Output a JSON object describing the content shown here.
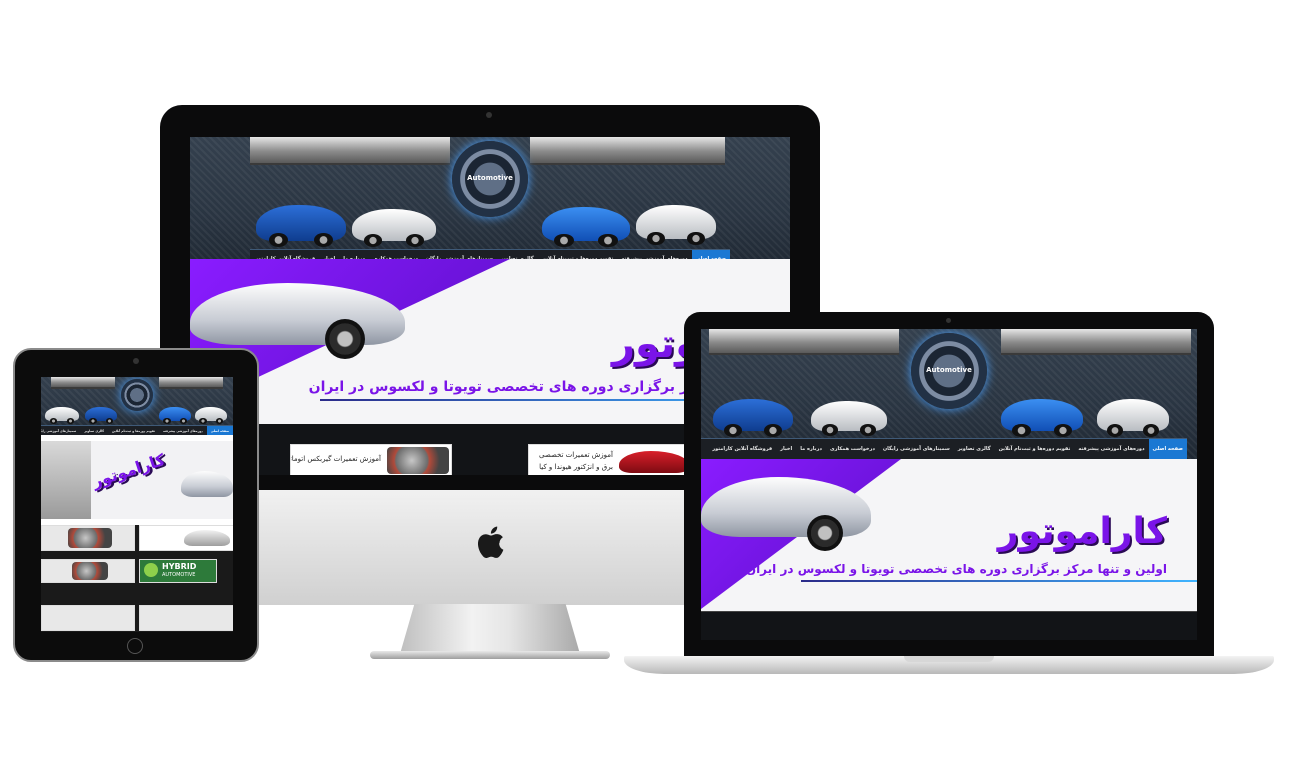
{
  "site": {
    "logo_text": "Automotive",
    "nav_items": [
      "صفحه اصلی",
      "دوره‌های آموزشی پیشرفته",
      "تقویم دوره‌ها و ثبت‌نام آنلاین",
      "گالری تصاویر",
      "سمینارهای آموزشی رایگان",
      "درخواست همکاری",
      "درباره ما",
      "اخبار",
      "فروشگاه آنلاین کارامتور"
    ],
    "hero_title": "کاراموتور",
    "hero_subtitle": "اولین و تنها مرکز برگزاری دوره های تخصصی تویوتا و لکسوس در ایران",
    "card_1": "آموزش تعمیرات گیربکس اتوماتیک",
    "card_2": "آموزش تعمیرات تخصصی برق و انژکتور هیوندا و کیا",
    "hybrid_label": "HYBRID",
    "hybrid_sub": "AUTOMOTIVE"
  },
  "colors": {
    "accent_purple": "#7a14e8",
    "nav_active": "#1b78d3",
    "header_bg": "#2a3542"
  },
  "icons": {
    "desktop_brand": "apple-logo-icon"
  }
}
